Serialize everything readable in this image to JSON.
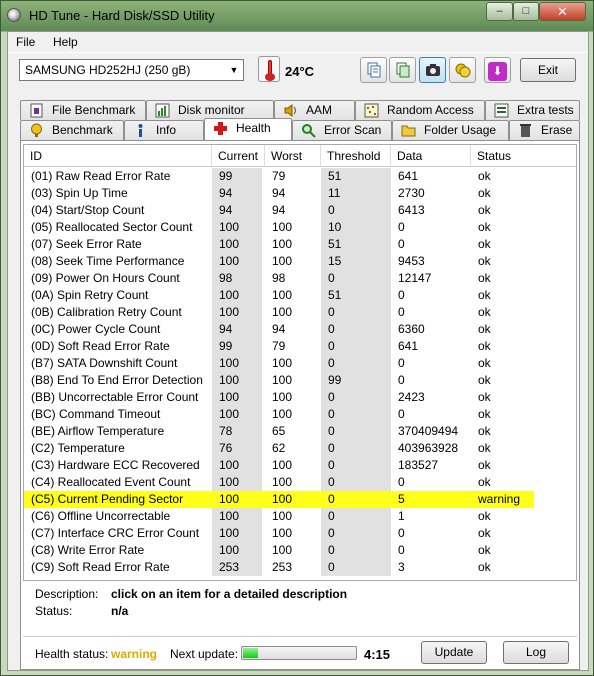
{
  "window": {
    "title": "HD Tune - Hard Disk/SSD Utility",
    "minimize": "–",
    "maximize": "□",
    "close": "✕"
  },
  "menu": {
    "file": "File",
    "help": "Help"
  },
  "toolbar": {
    "drive": "SAMSUNG HD252HJ (250 gB)",
    "temperature": "24°C",
    "exit": "Exit",
    "icons": [
      "copy-text-icon",
      "copy-screenshot-icon",
      "camera-icon",
      "options-icon",
      "save-down-icon"
    ]
  },
  "tabs_row1": [
    {
      "label": "File Benchmark",
      "icon": "file-benchmark-icon"
    },
    {
      "label": "Disk monitor",
      "icon": "disk-monitor-icon"
    },
    {
      "label": "AAM",
      "icon": "speaker-icon"
    },
    {
      "label": "Random Access",
      "icon": "random-access-icon"
    },
    {
      "label": "Extra tests",
      "icon": "extra-tests-icon"
    }
  ],
  "tabs_row2": [
    {
      "label": "Benchmark",
      "icon": "benchmark-icon"
    },
    {
      "label": "Info",
      "icon": "info-icon"
    },
    {
      "label": "Health",
      "icon": "health-cross-icon",
      "active": true
    },
    {
      "label": "Error Scan",
      "icon": "magnifier-icon"
    },
    {
      "label": "Folder Usage",
      "icon": "folder-icon"
    },
    {
      "label": "Erase",
      "icon": "trash-icon"
    }
  ],
  "grid": {
    "headers": [
      "ID",
      "Current",
      "Worst",
      "Threshold",
      "Data",
      "Status"
    ],
    "rows": [
      [
        "(01) Raw Read Error Rate",
        "99",
        "79",
        "51",
        "641",
        "ok"
      ],
      [
        "(03) Spin Up Time",
        "94",
        "94",
        "11",
        "2730",
        "ok"
      ],
      [
        "(04) Start/Stop Count",
        "94",
        "94",
        "0",
        "6413",
        "ok"
      ],
      [
        "(05) Reallocated Sector Count",
        "100",
        "100",
        "10",
        "0",
        "ok"
      ],
      [
        "(07) Seek Error Rate",
        "100",
        "100",
        "51",
        "0",
        "ok"
      ],
      [
        "(08) Seek Time Performance",
        "100",
        "100",
        "15",
        "9453",
        "ok"
      ],
      [
        "(09) Power On Hours Count",
        "98",
        "98",
        "0",
        "12147",
        "ok"
      ],
      [
        "(0A) Spin Retry Count",
        "100",
        "100",
        "51",
        "0",
        "ok"
      ],
      [
        "(0B) Calibration Retry Count",
        "100",
        "100",
        "0",
        "0",
        "ok"
      ],
      [
        "(0C) Power Cycle Count",
        "94",
        "94",
        "0",
        "6360",
        "ok"
      ],
      [
        "(0D) Soft Read Error Rate",
        "99",
        "79",
        "0",
        "641",
        "ok"
      ],
      [
        "(B7) SATA Downshift Count",
        "100",
        "100",
        "0",
        "0",
        "ok"
      ],
      [
        "(B8) End To End Error Detection",
        "100",
        "100",
        "99",
        "0",
        "ok"
      ],
      [
        "(BB) Uncorrectable Error Count",
        "100",
        "100",
        "0",
        "2423",
        "ok"
      ],
      [
        "(BC) Command Timeout",
        "100",
        "100",
        "0",
        "0",
        "ok"
      ],
      [
        "(BE) Airflow Temperature",
        "78",
        "65",
        "0",
        "370409494",
        "ok"
      ],
      [
        "(C2) Temperature",
        "76",
        "62",
        "0",
        "403963928",
        "ok"
      ],
      [
        "(C3) Hardware ECC Recovered",
        "100",
        "100",
        "0",
        "183527",
        "ok"
      ],
      [
        "(C4) Reallocated Event Count",
        "100",
        "100",
        "0",
        "0",
        "ok"
      ],
      [
        "(C5) Current Pending Sector",
        "100",
        "100",
        "0",
        "5",
        "warning"
      ],
      [
        "(C6) Offline Uncorrectable",
        "100",
        "100",
        "0",
        "1",
        "ok"
      ],
      [
        "(C7) Interface CRC Error Count",
        "100",
        "100",
        "0",
        "0",
        "ok"
      ],
      [
        "(C8) Write Error Rate",
        "100",
        "100",
        "0",
        "0",
        "ok"
      ],
      [
        "(C9) Soft Read Error Rate",
        "253",
        "253",
        "0",
        "3",
        "ok"
      ]
    ],
    "highlight_color": "#ffff1a"
  },
  "description": {
    "label": "Description:",
    "value": "click on an item for a detailed description",
    "status_label": "Status:",
    "status_value": "n/a"
  },
  "footer": {
    "health_label": "Health status:",
    "health_value": "warning",
    "health_color": "#e0a800",
    "next_update_label": "Next update:",
    "progress_fraction": 0.13,
    "countdown": "4:15",
    "update": "Update",
    "log": "Log"
  }
}
